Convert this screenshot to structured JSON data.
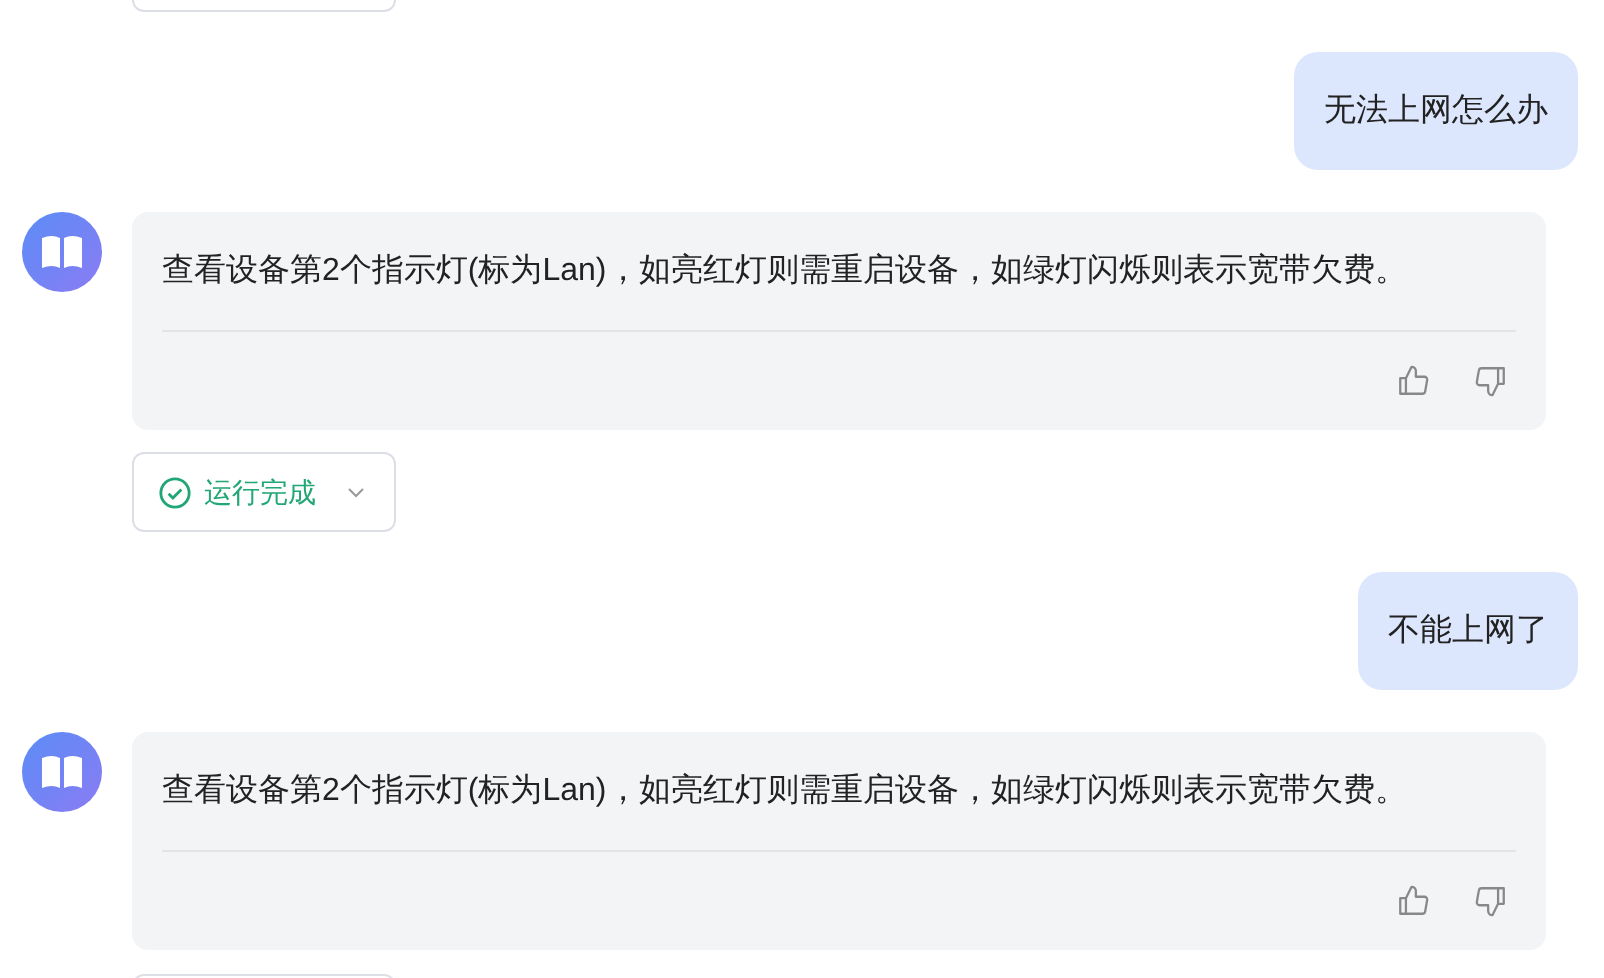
{
  "messages": [
    {
      "kind": "user",
      "text": "无法上网怎么办"
    },
    {
      "kind": "bot",
      "text": "查看设备第2个指示灯(标为Lan)，如亮红灯则需重启设备，如绿灯闪烁则表示宽带欠费。",
      "status": "运行完成"
    },
    {
      "kind": "user",
      "text": "不能上网了"
    },
    {
      "kind": "bot",
      "text": "查看设备第2个指示灯(标为Lan)，如亮红灯则需重启设备，如绿灯闪烁则表示宽带欠费。"
    }
  ]
}
